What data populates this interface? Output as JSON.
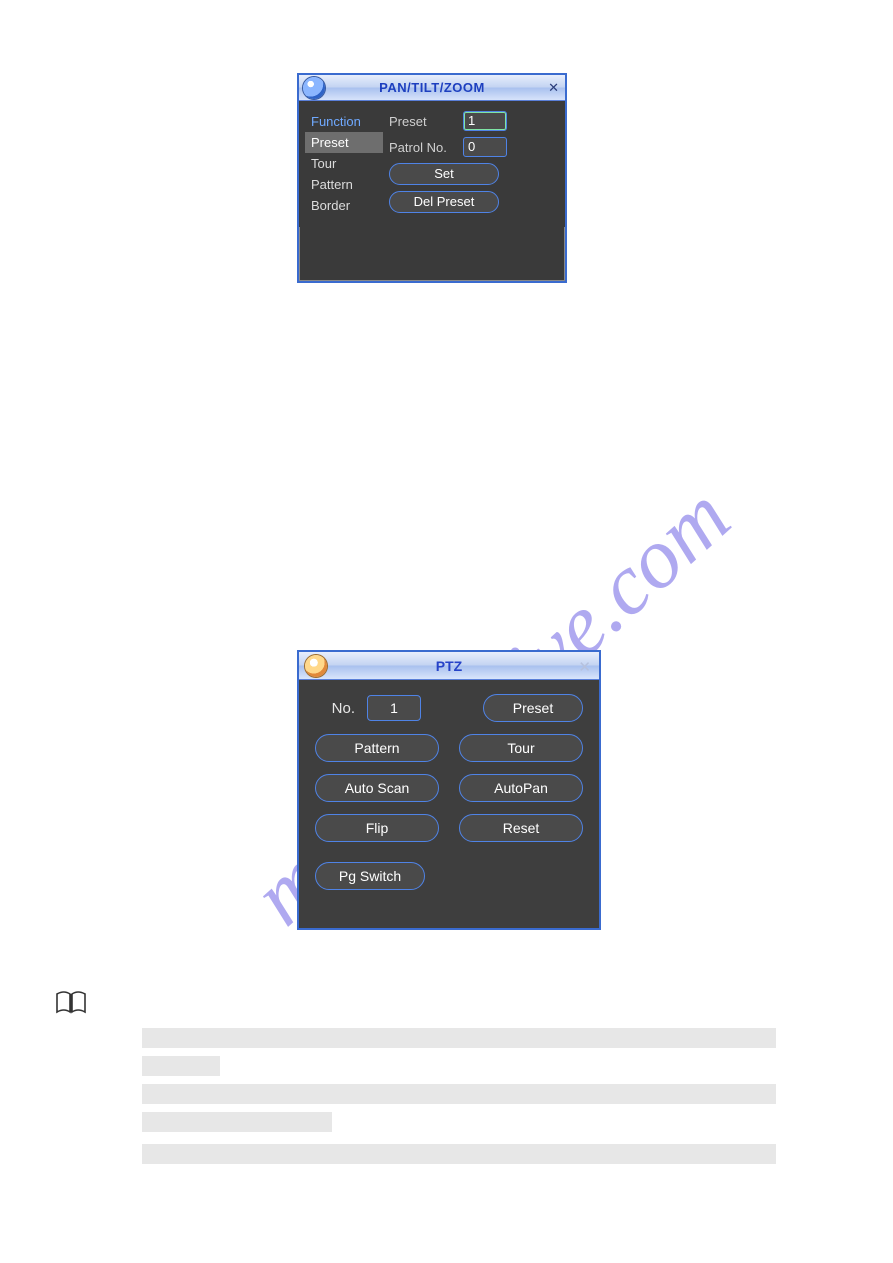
{
  "dialog1": {
    "title": "PAN/TILT/ZOOM",
    "close_glyph": "✕",
    "sidebar": {
      "items": [
        {
          "label": "Function",
          "fn": true
        },
        {
          "label": "Preset",
          "selected": true
        },
        {
          "label": "Tour"
        },
        {
          "label": "Pattern"
        },
        {
          "label": "Border"
        }
      ]
    },
    "fields": {
      "preset_label": "Preset",
      "preset_value": "1",
      "patrol_label": "Patrol No.",
      "patrol_value": "0"
    },
    "buttons": {
      "set": "Set",
      "del_preset": "Del Preset"
    }
  },
  "dialog2": {
    "title": "PTZ",
    "close_glyph": "✕",
    "no_label": "No.",
    "no_value": "1",
    "buttons": {
      "preset": "Preset",
      "pattern": "Pattern",
      "tour": "Tour",
      "auto_scan": "Auto Scan",
      "autopan": "AutoPan",
      "flip": "Flip",
      "reset": "Reset",
      "pg_switch": "Pg Switch"
    }
  },
  "watermark_text": "manualchive.com"
}
